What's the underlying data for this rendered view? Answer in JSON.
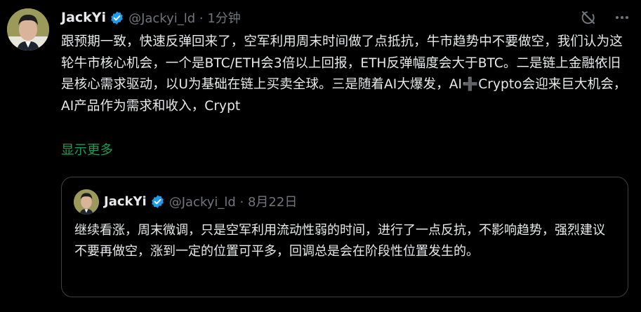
{
  "tweet": {
    "author_name": "JackYi",
    "handle_time": "@Jackyi_ld · 1分钟",
    "text_before_plus": "跟预期一致，快速反弹回来了，空军利用周末时间做了点抵抗，牛市趋势中不要做空，我们认为这轮牛市核心机会，一个是BTC/ETH会3倍以上回报，ETH反弹幅度会大于BTC。二是链上金融依旧是核心需求驱动，以U为基础在链上买卖全球。三是随着AI大爆发，AI",
    "plus_glyph": "➕",
    "text_after_plus": "Crypto会迎来巨大机会，AI产品作为需求和收入，Crypt",
    "show_more": "显示更多"
  },
  "quoted_tweet": {
    "author_name": "JackYi",
    "handle_date": "@Jackyi_ld · 8月22日",
    "text": "继续看涨，周末微调，只是空军利用流动性弱的时间，进行了一点反抗，不影响趋势，强烈建议不要再做空，涨到一定的位置可平多，回调总是会在阶段性位置发生的。"
  },
  "icons": [
    "avatar",
    "verified-badge-icon",
    "grok-icon",
    "more-icon"
  ],
  "colors": {
    "background": "#000000",
    "text": "#e7e9ea",
    "muted": "#71767b",
    "link_green": "#1d9b53",
    "verified_blue": "#1d9bf0",
    "border": "#3e4144"
  }
}
